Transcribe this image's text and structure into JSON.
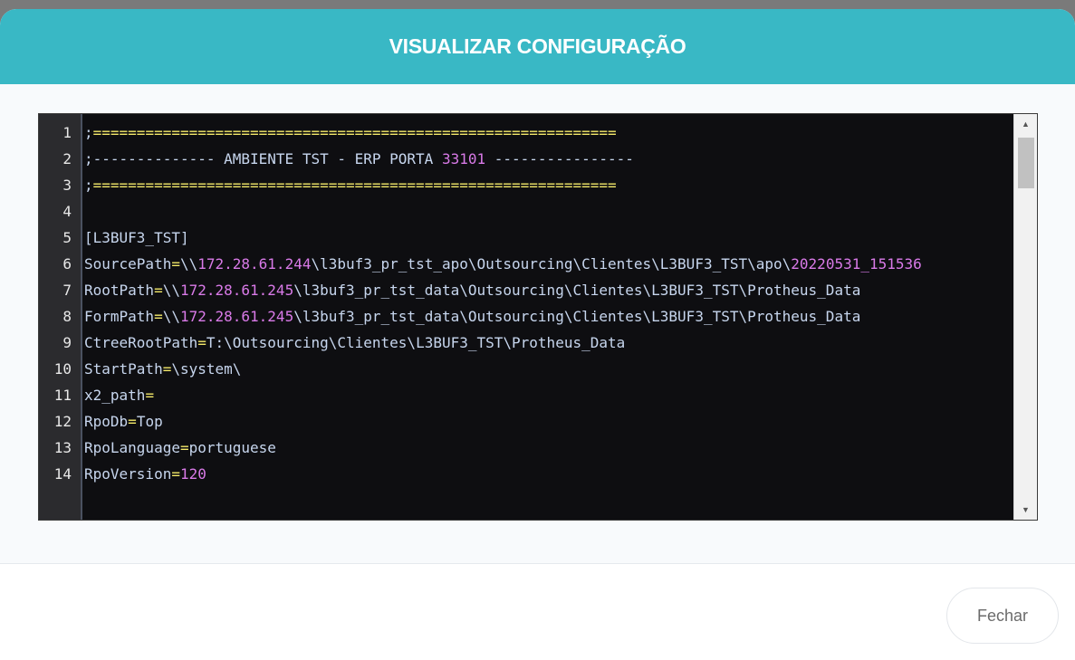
{
  "modal": {
    "title": "VISUALIZAR CONFIGURAÇÃO",
    "close_label": "Fechar"
  },
  "colors": {
    "header": "#39b8c5",
    "editor_bg": "#0e0e11",
    "token_yellow": "#f4e96a",
    "token_magenta": "#d97ae8",
    "token_default": "#c7d6ee"
  },
  "scrollbar": {
    "up_icon": "▲",
    "down_icon": "▼"
  },
  "editor": {
    "lines": [
      {
        "n": "1",
        "tokens": [
          {
            "t": ";",
            "c": "d"
          },
          {
            "t": "============================================================",
            "c": "y"
          }
        ]
      },
      {
        "n": "2",
        "tokens": [
          {
            "t": ";-------------- AMBIENTE TST - ERP PORTA ",
            "c": "d"
          },
          {
            "t": "33101",
            "c": "m"
          },
          {
            "t": " ----------------",
            "c": "d"
          }
        ]
      },
      {
        "n": "3",
        "tokens": [
          {
            "t": ";",
            "c": "d"
          },
          {
            "t": "============================================================",
            "c": "y"
          }
        ]
      },
      {
        "n": "4",
        "tokens": [
          {
            "t": "",
            "c": "d"
          }
        ]
      },
      {
        "n": "5",
        "tokens": [
          {
            "t": "[L3BUF3_TST]",
            "c": "d"
          }
        ]
      },
      {
        "n": "6",
        "tokens": [
          {
            "t": "SourcePath",
            "c": "d"
          },
          {
            "t": "=",
            "c": "y"
          },
          {
            "t": "\\\\",
            "c": "d"
          },
          {
            "t": "172.28.61.244",
            "c": "m"
          },
          {
            "t": "\\l3buf3_pr_tst_apo\\Outsourcing\\Clientes\\L3BUF3_TST\\apo\\",
            "c": "d"
          },
          {
            "t": "20220531_151536",
            "c": "m"
          }
        ]
      },
      {
        "n": "7",
        "tokens": [
          {
            "t": "RootPath",
            "c": "d"
          },
          {
            "t": "=",
            "c": "y"
          },
          {
            "t": "\\\\",
            "c": "d"
          },
          {
            "t": "172.28.61.245",
            "c": "m"
          },
          {
            "t": "\\l3buf3_pr_tst_data\\Outsourcing\\Clientes\\L3BUF3_TST\\Protheus_Data",
            "c": "d"
          }
        ]
      },
      {
        "n": "8",
        "tokens": [
          {
            "t": "FormPath",
            "c": "d"
          },
          {
            "t": "=",
            "c": "y"
          },
          {
            "t": "\\\\",
            "c": "d"
          },
          {
            "t": "172.28.61.245",
            "c": "m"
          },
          {
            "t": "\\l3buf3_pr_tst_data\\Outsourcing\\Clientes\\L3BUF3_TST\\Protheus_Data",
            "c": "d"
          }
        ]
      },
      {
        "n": "9",
        "tokens": [
          {
            "t": "CtreeRootPath",
            "c": "d"
          },
          {
            "t": "=",
            "c": "y"
          },
          {
            "t": "T:\\Outsourcing\\Clientes\\L3BUF3_TST\\Protheus_Data",
            "c": "d"
          }
        ]
      },
      {
        "n": "10",
        "tokens": [
          {
            "t": "StartPath",
            "c": "d"
          },
          {
            "t": "=",
            "c": "y"
          },
          {
            "t": "\\system\\",
            "c": "d"
          }
        ]
      },
      {
        "n": "11",
        "tokens": [
          {
            "t": "x2_path",
            "c": "d"
          },
          {
            "t": "=",
            "c": "y"
          }
        ]
      },
      {
        "n": "12",
        "tokens": [
          {
            "t": "RpoDb",
            "c": "d"
          },
          {
            "t": "=",
            "c": "y"
          },
          {
            "t": "Top",
            "c": "d"
          }
        ]
      },
      {
        "n": "13",
        "tokens": [
          {
            "t": "RpoLanguage",
            "c": "d"
          },
          {
            "t": "=",
            "c": "y"
          },
          {
            "t": "portuguese",
            "c": "d"
          }
        ]
      },
      {
        "n": "14",
        "tokens": [
          {
            "t": "RpoVersion",
            "c": "d"
          },
          {
            "t": "=",
            "c": "y"
          },
          {
            "t": "120",
            "c": "m"
          }
        ]
      }
    ]
  }
}
